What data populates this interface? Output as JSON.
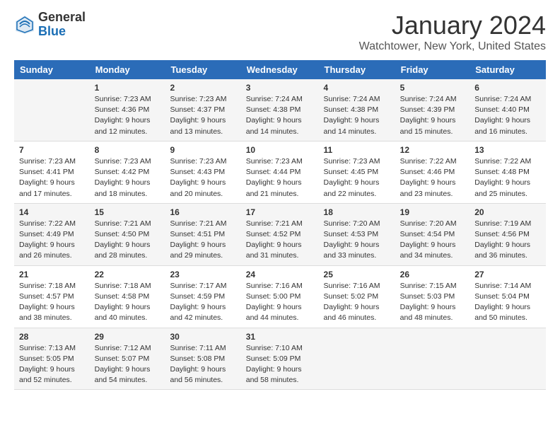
{
  "header": {
    "logo_general": "General",
    "logo_blue": "Blue",
    "month_title": "January 2024",
    "location": "Watchtower, New York, United States"
  },
  "weekdays": [
    "Sunday",
    "Monday",
    "Tuesday",
    "Wednesday",
    "Thursday",
    "Friday",
    "Saturday"
  ],
  "weeks": [
    [
      {
        "day": "",
        "sunrise": "",
        "sunset": "",
        "daylight": ""
      },
      {
        "day": "1",
        "sunrise": "Sunrise: 7:23 AM",
        "sunset": "Sunset: 4:36 PM",
        "daylight": "Daylight: 9 hours and 12 minutes."
      },
      {
        "day": "2",
        "sunrise": "Sunrise: 7:23 AM",
        "sunset": "Sunset: 4:37 PM",
        "daylight": "Daylight: 9 hours and 13 minutes."
      },
      {
        "day": "3",
        "sunrise": "Sunrise: 7:24 AM",
        "sunset": "Sunset: 4:38 PM",
        "daylight": "Daylight: 9 hours and 14 minutes."
      },
      {
        "day": "4",
        "sunrise": "Sunrise: 7:24 AM",
        "sunset": "Sunset: 4:38 PM",
        "daylight": "Daylight: 9 hours and 14 minutes."
      },
      {
        "day": "5",
        "sunrise": "Sunrise: 7:24 AM",
        "sunset": "Sunset: 4:39 PM",
        "daylight": "Daylight: 9 hours and 15 minutes."
      },
      {
        "day": "6",
        "sunrise": "Sunrise: 7:24 AM",
        "sunset": "Sunset: 4:40 PM",
        "daylight": "Daylight: 9 hours and 16 minutes."
      }
    ],
    [
      {
        "day": "7",
        "sunrise": "Sunrise: 7:23 AM",
        "sunset": "Sunset: 4:41 PM",
        "daylight": "Daylight: 9 hours and 17 minutes."
      },
      {
        "day": "8",
        "sunrise": "Sunrise: 7:23 AM",
        "sunset": "Sunset: 4:42 PM",
        "daylight": "Daylight: 9 hours and 18 minutes."
      },
      {
        "day": "9",
        "sunrise": "Sunrise: 7:23 AM",
        "sunset": "Sunset: 4:43 PM",
        "daylight": "Daylight: 9 hours and 20 minutes."
      },
      {
        "day": "10",
        "sunrise": "Sunrise: 7:23 AM",
        "sunset": "Sunset: 4:44 PM",
        "daylight": "Daylight: 9 hours and 21 minutes."
      },
      {
        "day": "11",
        "sunrise": "Sunrise: 7:23 AM",
        "sunset": "Sunset: 4:45 PM",
        "daylight": "Daylight: 9 hours and 22 minutes."
      },
      {
        "day": "12",
        "sunrise": "Sunrise: 7:22 AM",
        "sunset": "Sunset: 4:46 PM",
        "daylight": "Daylight: 9 hours and 23 minutes."
      },
      {
        "day": "13",
        "sunrise": "Sunrise: 7:22 AM",
        "sunset": "Sunset: 4:48 PM",
        "daylight": "Daylight: 9 hours and 25 minutes."
      }
    ],
    [
      {
        "day": "14",
        "sunrise": "Sunrise: 7:22 AM",
        "sunset": "Sunset: 4:49 PM",
        "daylight": "Daylight: 9 hours and 26 minutes."
      },
      {
        "day": "15",
        "sunrise": "Sunrise: 7:21 AM",
        "sunset": "Sunset: 4:50 PM",
        "daylight": "Daylight: 9 hours and 28 minutes."
      },
      {
        "day": "16",
        "sunrise": "Sunrise: 7:21 AM",
        "sunset": "Sunset: 4:51 PM",
        "daylight": "Daylight: 9 hours and 29 minutes."
      },
      {
        "day": "17",
        "sunrise": "Sunrise: 7:21 AM",
        "sunset": "Sunset: 4:52 PM",
        "daylight": "Daylight: 9 hours and 31 minutes."
      },
      {
        "day": "18",
        "sunrise": "Sunrise: 7:20 AM",
        "sunset": "Sunset: 4:53 PM",
        "daylight": "Daylight: 9 hours and 33 minutes."
      },
      {
        "day": "19",
        "sunrise": "Sunrise: 7:20 AM",
        "sunset": "Sunset: 4:54 PM",
        "daylight": "Daylight: 9 hours and 34 minutes."
      },
      {
        "day": "20",
        "sunrise": "Sunrise: 7:19 AM",
        "sunset": "Sunset: 4:56 PM",
        "daylight": "Daylight: 9 hours and 36 minutes."
      }
    ],
    [
      {
        "day": "21",
        "sunrise": "Sunrise: 7:18 AM",
        "sunset": "Sunset: 4:57 PM",
        "daylight": "Daylight: 9 hours and 38 minutes."
      },
      {
        "day": "22",
        "sunrise": "Sunrise: 7:18 AM",
        "sunset": "Sunset: 4:58 PM",
        "daylight": "Daylight: 9 hours and 40 minutes."
      },
      {
        "day": "23",
        "sunrise": "Sunrise: 7:17 AM",
        "sunset": "Sunset: 4:59 PM",
        "daylight": "Daylight: 9 hours and 42 minutes."
      },
      {
        "day": "24",
        "sunrise": "Sunrise: 7:16 AM",
        "sunset": "Sunset: 5:00 PM",
        "daylight": "Daylight: 9 hours and 44 minutes."
      },
      {
        "day": "25",
        "sunrise": "Sunrise: 7:16 AM",
        "sunset": "Sunset: 5:02 PM",
        "daylight": "Daylight: 9 hours and 46 minutes."
      },
      {
        "day": "26",
        "sunrise": "Sunrise: 7:15 AM",
        "sunset": "Sunset: 5:03 PM",
        "daylight": "Daylight: 9 hours and 48 minutes."
      },
      {
        "day": "27",
        "sunrise": "Sunrise: 7:14 AM",
        "sunset": "Sunset: 5:04 PM",
        "daylight": "Daylight: 9 hours and 50 minutes."
      }
    ],
    [
      {
        "day": "28",
        "sunrise": "Sunrise: 7:13 AM",
        "sunset": "Sunset: 5:05 PM",
        "daylight": "Daylight: 9 hours and 52 minutes."
      },
      {
        "day": "29",
        "sunrise": "Sunrise: 7:12 AM",
        "sunset": "Sunset: 5:07 PM",
        "daylight": "Daylight: 9 hours and 54 minutes."
      },
      {
        "day": "30",
        "sunrise": "Sunrise: 7:11 AM",
        "sunset": "Sunset: 5:08 PM",
        "daylight": "Daylight: 9 hours and 56 minutes."
      },
      {
        "day": "31",
        "sunrise": "Sunrise: 7:10 AM",
        "sunset": "Sunset: 5:09 PM",
        "daylight": "Daylight: 9 hours and 58 minutes."
      },
      {
        "day": "",
        "sunrise": "",
        "sunset": "",
        "daylight": ""
      },
      {
        "day": "",
        "sunrise": "",
        "sunset": "",
        "daylight": ""
      },
      {
        "day": "",
        "sunrise": "",
        "sunset": "",
        "daylight": ""
      }
    ]
  ]
}
